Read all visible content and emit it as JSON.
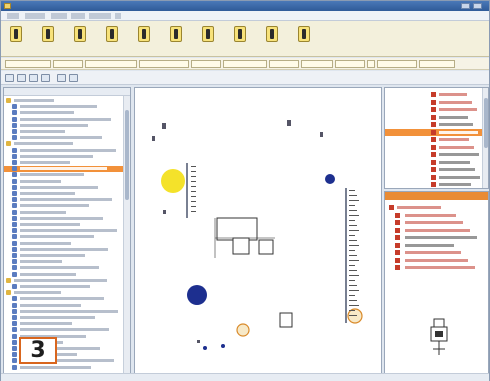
{
  "window": {
    "title": ""
  },
  "menubar": {
    "items": [
      "",
      "",
      "",
      "",
      "",
      ""
    ]
  },
  "toolbar": {
    "tools": [
      {
        "label": ""
      },
      {
        "label": ""
      },
      {
        "label": ""
      },
      {
        "label": ""
      },
      {
        "label": ""
      },
      {
        "label": ""
      },
      {
        "label": ""
      },
      {
        "label": ""
      },
      {
        "label": ""
      },
      {
        "label": ""
      }
    ],
    "links": [
      "",
      "",
      "",
      "",
      "",
      "",
      "",
      "",
      "",
      "",
      "",
      ""
    ]
  },
  "left_panel": {
    "header": ""
  },
  "badge": {
    "number": "3"
  },
  "colors": {
    "accent": "#f2913a",
    "badge_border": "#d9661e",
    "node_blue": "#1d2f8f",
    "node_yellow": "#f4e22a"
  }
}
